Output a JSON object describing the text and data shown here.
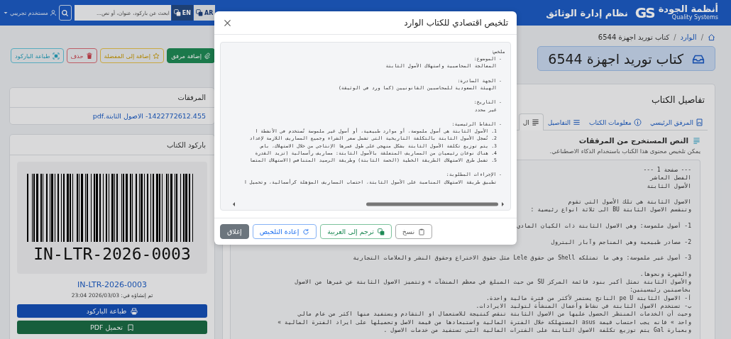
{
  "navbar": {
    "brand_name": "أنظمة الجودة",
    "brand_subtitle": "Quality Systems",
    "brand_logo": "GS",
    "app_title": "نظام إدارة الوثائق",
    "languages": [
      {
        "label": "AR",
        "selected": true
      },
      {
        "label": "EN",
        "selected": false
      }
    ],
    "search": {
      "placeholder": "ابحث عن باركود، عنوان، أو نص..."
    },
    "user": "مستخدم تجريبي"
  },
  "breadcrumb": [
    {
      "kind": "home"
    },
    {
      "kind": "separator",
      "text": "/"
    },
    {
      "kind": "link",
      "text": "الوارد"
    },
    {
      "kind": "separator",
      "text": "/"
    },
    {
      "kind": "current",
      "text": "كتاب توريد اجهزة 6544"
    }
  ],
  "page_title": "كتاب توريد اجهزة 6544",
  "details": {
    "title": "تفاصيل الكتاب",
    "tabs": [
      {
        "label": "المرفق الرئيسي",
        "selected": false
      },
      {
        "label": "معلومات الكتاب",
        "selected": false
      },
      {
        "label": "التفاصيل",
        "selected": false
      },
      {
        "label": "ال",
        "selected": true
      }
    ],
    "section_title": "النص المستخرج من المرفقات",
    "section_note": "يمكن تلخيص محتوى هذا الكتاب باستخدام الذكاء الاصطناعي.",
    "extracted_text": [
      [
        "--- صفحة 1 ---",
        "الفصل العاشر",
        "الأصول الثابتة"
      ],
      [
        "الاصول الثابتة هي تلك الأصول التي تقوم",
        "وتنقسم الاصول الثابتة BU الى ثلاثة انواع رئيسية :"
      ],
      [
        "1- أصول ملموسة: وهي الاصول الثابتة ذات الكيان المادي"
      ],
      [
        "2- مصادر طبيعية وهي المناجم وآبار البترول"
      ],
      [
        "3- أصول غير ملموسة: وهي ما تمتلكه Shell من حقوق Lele مثل حقوق الاختراع وحقوق النشر والعلامات التجارية"
      ],
      [
        "والشهرة ونحوها.",
        "والأصول الثابتة تمثل أكبر بنود قائمة المركز SU من حيث المبلغ في معظم المنشآت » وتتميز الاصول الثابتة عن غيرها من الاصول",
        "بخاصيتين رئيسيتين:",
        "أ- الاصول الثابتة pe U الناتج يستمر لأكثر من فترة مالية واحدة.",
        "ب- تستخدم الاصول الثابتة في نشاط وأعمال المنشأة لتوليد الايرادات.",
        "وحيث أن الخدمات المنتظر الحصول عليها من الاصول الثابتة تنقص كنتيجة للاستعمال او التقادم ويستفيد منها اكثر من عام مالي",
        "واحد » فانه يجب احتساب قيمة asus المستهلكة خلال الفترة المالية واستبعادها من قيمة الاصل وتحميلها على ايراد الفترة المالية »",
        "وبعبارة Gal يتم توزيع تكلفة الاصول الثابتة على الفترات المالية التي تستفيد من خدمات الاصول ."
      ]
    ]
  },
  "actions": [
    {
      "label": "إضافة مرفق",
      "kind": "add"
    },
    {
      "label": "إضافة إلى المفضلة",
      "kind": "favorite"
    },
    {
      "label": "حذف",
      "kind": "delete"
    },
    {
      "label": "طباعة الباركود",
      "kind": "print"
    }
  ],
  "attachments": {
    "title": "المرفقات",
    "files": [
      "1422772612.455- الاصول الثابتة.pdf"
    ]
  },
  "barcode": {
    "title": "باركود الكتاب",
    "code": "IN-LTR-2026-0003",
    "link": "IN-LTR-2026-0003",
    "created": "تم إنشاؤه في: 2026/03/03 23:04",
    "buttons": [
      {
        "label": "طباعة الباركود",
        "kind": "print"
      },
      {
        "label": "تحميل PDF",
        "kind": "download"
      }
    ]
  },
  "modal": {
    "title": "تلخيص اقتصادي للكتاب الوارد",
    "summary": {
      "heading": "ملخص:",
      "sections": [
        {
          "label": "- الموضوع:",
          "lines": [
            "المعالجة المحاسبية واستهلاك الأصول الثابتة"
          ]
        },
        {
          "label": "- الجهة الصادرة:",
          "lines": [
            "الهيئة السعودية للمحاسبين القانونيين (كما ورد في الوثيقة)"
          ]
        },
        {
          "label": "- التاريخ:",
          "lines": [
            "غير محدد"
          ]
        },
        {
          "label": "- النقاط الرئيسية:",
          "lines": [
            "1. الأصول الثابتة هي أصول ملموسة، أو موارد طبيعية، أو أصول غير ملموسة تُستخدم في الأنشطة ا",
            "2. تُسجل الأصول الثابتة بالتكلفة التاريخية التي تشمل سعر الشراء وجميع المصاريف اللازمة لإعداد",
            "3. يتم توزيع تكلفة الأصول الثابتة بشكل منهجي على طول عمرها الإنتاجي من خلال الاستهلاك، باس",
            "4. هناك نوعان رئيسيان من المصاريف المتعلقة بالأصول الثابتة: مصاريف رأسمالية (تزيد القدرة",
            "5. تشمل طرق الاستهلاك الطريقة الخطية (الحصة الثابتة) وطريقة الرصيد المتناقص (الاستهلاك المتسا"
          ]
        },
        {
          "label": "- الإجراءات المطلوبة:",
          "lines": [
            "تطبيق طريقة الاستهلاك المناسبة على الأصول الثابتة، احتساب المصاريف المؤهلة كرأسمالية، وتحميل ا"
          ]
        }
      ]
    },
    "buttons": [
      {
        "label": "نسخ",
        "kind": "copy"
      },
      {
        "label": "ترجم إلى العربية",
        "kind": "translate"
      },
      {
        "label": "إعادة التلخيص",
        "kind": "refresh"
      },
      {
        "label": "إغلاق",
        "kind": "close"
      }
    ]
  }
}
